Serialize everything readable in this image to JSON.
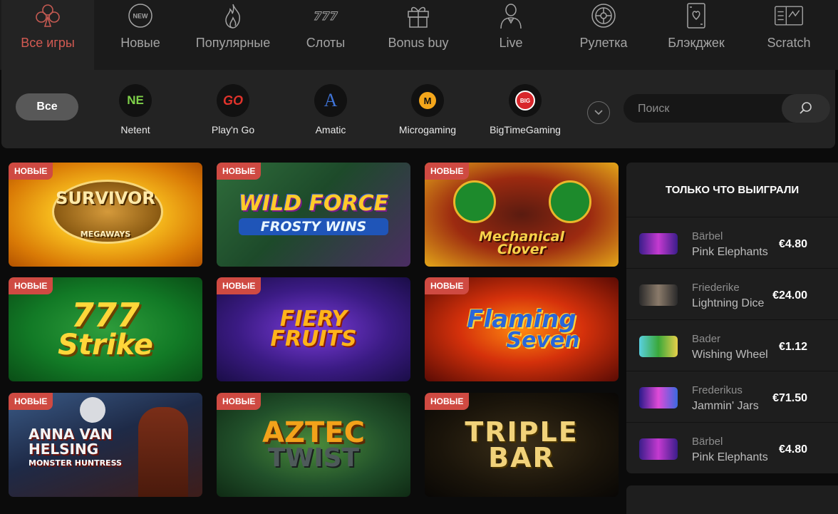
{
  "categories": [
    {
      "label": "Все игры",
      "icon": "club-icon"
    },
    {
      "label": "Новые",
      "icon": "new-badge-icon"
    },
    {
      "label": "Популярные",
      "icon": "flame-icon"
    },
    {
      "label": "Слоты",
      "icon": "777-icon"
    },
    {
      "label": "Bonus buy",
      "icon": "gift-icon"
    },
    {
      "label": "Live",
      "icon": "dealer-icon"
    },
    {
      "label": "Рулетка",
      "icon": "roulette-icon"
    },
    {
      "label": "Блэкджек",
      "icon": "card-icon"
    },
    {
      "label": "Scratch",
      "icon": "scratch-card-icon"
    }
  ],
  "category_icon_text": {
    "new": "NEW",
    "slots": "777"
  },
  "providers": {
    "all_label": "Все",
    "items": [
      {
        "name": "Netent",
        "logo": "NE"
      },
      {
        "name": "Play'n Go",
        "logo": "GO"
      },
      {
        "name": "Amatic",
        "logo": "A"
      },
      {
        "name": "Microgaming",
        "logo": "M"
      },
      {
        "name": "BigTimeGaming",
        "logo": "BIG"
      }
    ]
  },
  "search": {
    "placeholder": "Поиск"
  },
  "badge_label": "НОВЫЕ",
  "games": [
    {
      "title": "SURVIVOR",
      "subtitle": "MEGAWAYS"
    },
    {
      "title": "WILD FORCE",
      "subtitle": "FROSTY WINS"
    },
    {
      "title": "Mechanical",
      "subtitle": "Clover"
    },
    {
      "title": "777",
      "subtitle": "Strike"
    },
    {
      "title": "FIERY",
      "subtitle": "FRUITS"
    },
    {
      "title": "Flaming",
      "subtitle": "Seven"
    },
    {
      "title": "ANNA VAN HELSING",
      "subtitle": "MONSTER HUNTRESS"
    },
    {
      "title": "AZTEC",
      "subtitle": "TWIST"
    },
    {
      "title": "TRIPLE",
      "subtitle": "BAR"
    }
  ],
  "winners": {
    "title": "ТОЛЬКО ЧТО ВЫИГРАЛИ",
    "items": [
      {
        "user": "Bärbel",
        "game": "Pink Elephants",
        "amount": "€4.80"
      },
      {
        "user": "Friederike",
        "game": "Lightning Dice",
        "amount": "€24.00"
      },
      {
        "user": "Bader",
        "game": "Wishing Wheel",
        "amount": "€1.12"
      },
      {
        "user": "Frederikus",
        "game": "Jammin' Jars",
        "amount": "€71.50"
      },
      {
        "user": "Bärbel",
        "game": "Pink Elephants",
        "amount": "€4.80"
      }
    ]
  },
  "colors": {
    "accent": "#d35a52",
    "badge": "#cf4a42",
    "background": "#0b0b0b",
    "panel": "#1e1e1e"
  }
}
